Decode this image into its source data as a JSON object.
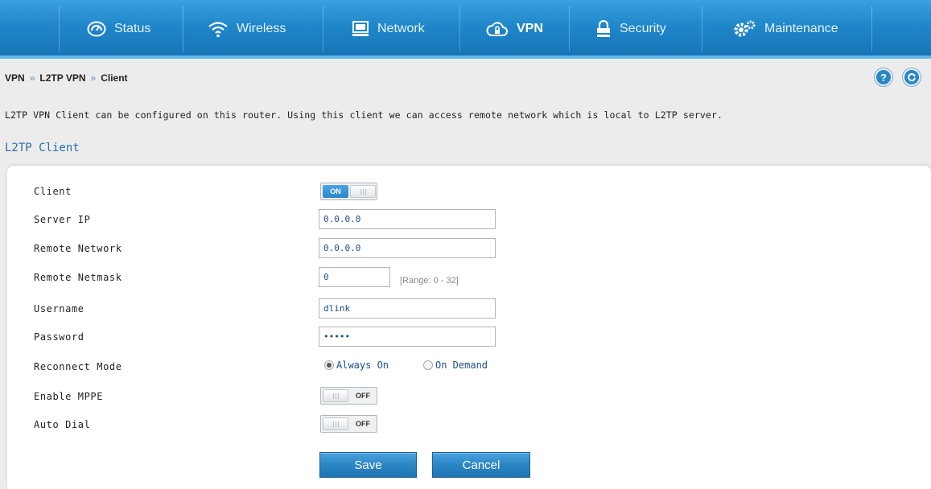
{
  "nav": {
    "items": [
      {
        "label": "Status",
        "icon": "dashboard-gauge-icon"
      },
      {
        "label": "Wireless",
        "icon": "wifi-icon"
      },
      {
        "label": "Network",
        "icon": "monitor-icon"
      },
      {
        "label": "VPN",
        "icon": "cloud-lock-icon",
        "active": true
      },
      {
        "label": "Security",
        "icon": "lock-icon"
      },
      {
        "label": "Maintenance",
        "icon": "gears-icon"
      }
    ]
  },
  "breadcrumb": {
    "level1": "VPN",
    "level2": "L2TP VPN",
    "level3": "Client",
    "separator": "»"
  },
  "header_buttons": {
    "help": "?",
    "refresh": "refresh-icon"
  },
  "intro_text": "L2TP VPN Client can be configured on this router. Using this client we can access remote network which is local to L2TP server.",
  "section_title": "L2TP Client",
  "form": {
    "client": {
      "label": "Client",
      "state": "ON"
    },
    "server_ip": {
      "label": "Server IP",
      "value": "0.0.0.0"
    },
    "remote_network": {
      "label": "Remote Network",
      "value": "0.0.0.0"
    },
    "remote_netmask": {
      "label": "Remote Netmask",
      "value": "0",
      "hint": "[Range: 0 - 32]"
    },
    "username": {
      "label": "Username",
      "value": "dlink"
    },
    "password": {
      "label": "Password",
      "value": "•••••"
    },
    "reconnect_mode": {
      "label": "Reconnect Mode",
      "options": [
        "Always On",
        "On Demand"
      ],
      "selected": "Always On"
    },
    "enable_mppe": {
      "label": "Enable MPPE",
      "state": "OFF"
    },
    "auto_dial": {
      "label": "Auto Dial",
      "state": "OFF"
    }
  },
  "buttons": {
    "save": "Save",
    "cancel": "Cancel"
  },
  "colors": {
    "nav_blue": "#1f86c9",
    "accent": "#2a6fa6",
    "link_text": "#1e4e87"
  }
}
